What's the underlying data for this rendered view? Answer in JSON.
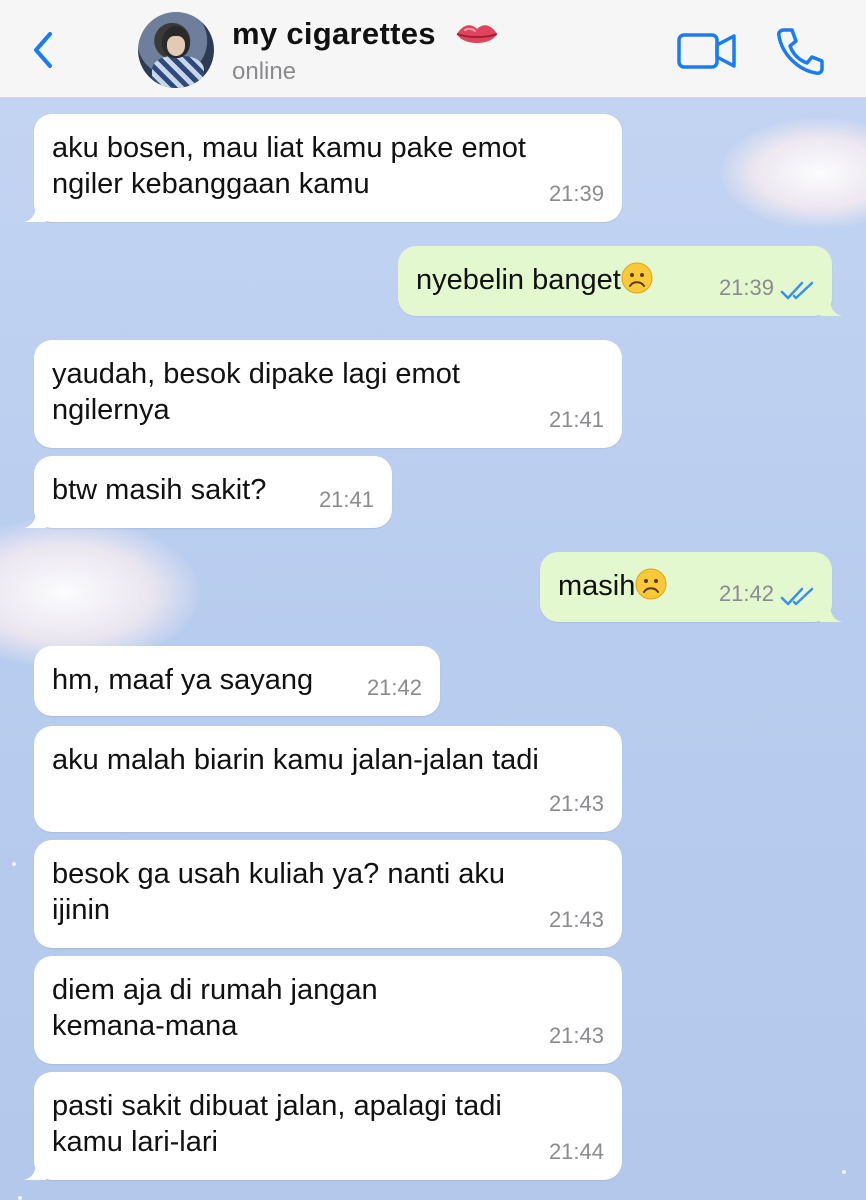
{
  "header": {
    "contact_name": "my cigarettes",
    "status": "online",
    "icons": {
      "back": "chevron-left-icon",
      "name_emoji": "lips-icon",
      "video": "video-camera-icon",
      "call": "phone-icon"
    },
    "accent_color": "#1a7cf5"
  },
  "messages": [
    {
      "dir": "in",
      "text": "aku bosen, mau liat kamu pake emot\nngiler kebanggaan kamu",
      "time": "21:39"
    },
    {
      "dir": "out",
      "text": "nyebelin banget",
      "emoji": "frowning-face",
      "time": "21:39",
      "read": true
    },
    {
      "dir": "in",
      "text": "yaudah, besok dipake lagi emot\nngilernya",
      "time": "21:41"
    },
    {
      "dir": "in",
      "text": "btw masih sakit?",
      "time": "21:41"
    },
    {
      "dir": "out",
      "text": "masih",
      "emoji": "frowning-face",
      "time": "21:42",
      "read": true
    },
    {
      "dir": "in",
      "text": "hm, maaf ya sayang",
      "time": "21:42"
    },
    {
      "dir": "in",
      "text": "aku malah biarin kamu jalan-jalan tadi",
      "time": "21:43"
    },
    {
      "dir": "in",
      "text": "besok ga usah kuliah ya? nanti aku\nijinin",
      "time": "21:43"
    },
    {
      "dir": "in",
      "text": "diem aja di rumah jangan\nkemana-mana",
      "time": "21:43"
    },
    {
      "dir": "in",
      "text": "pasti sakit dibuat jalan, apalagi tadi\nkamu lari-lari",
      "time": "21:44"
    }
  ],
  "colors": {
    "incoming_bubble": "#ffffff",
    "outgoing_bubble": "#e3f8cf",
    "read_ticks": "#3b8ff0",
    "wallpaper": "#b9cdef"
  }
}
